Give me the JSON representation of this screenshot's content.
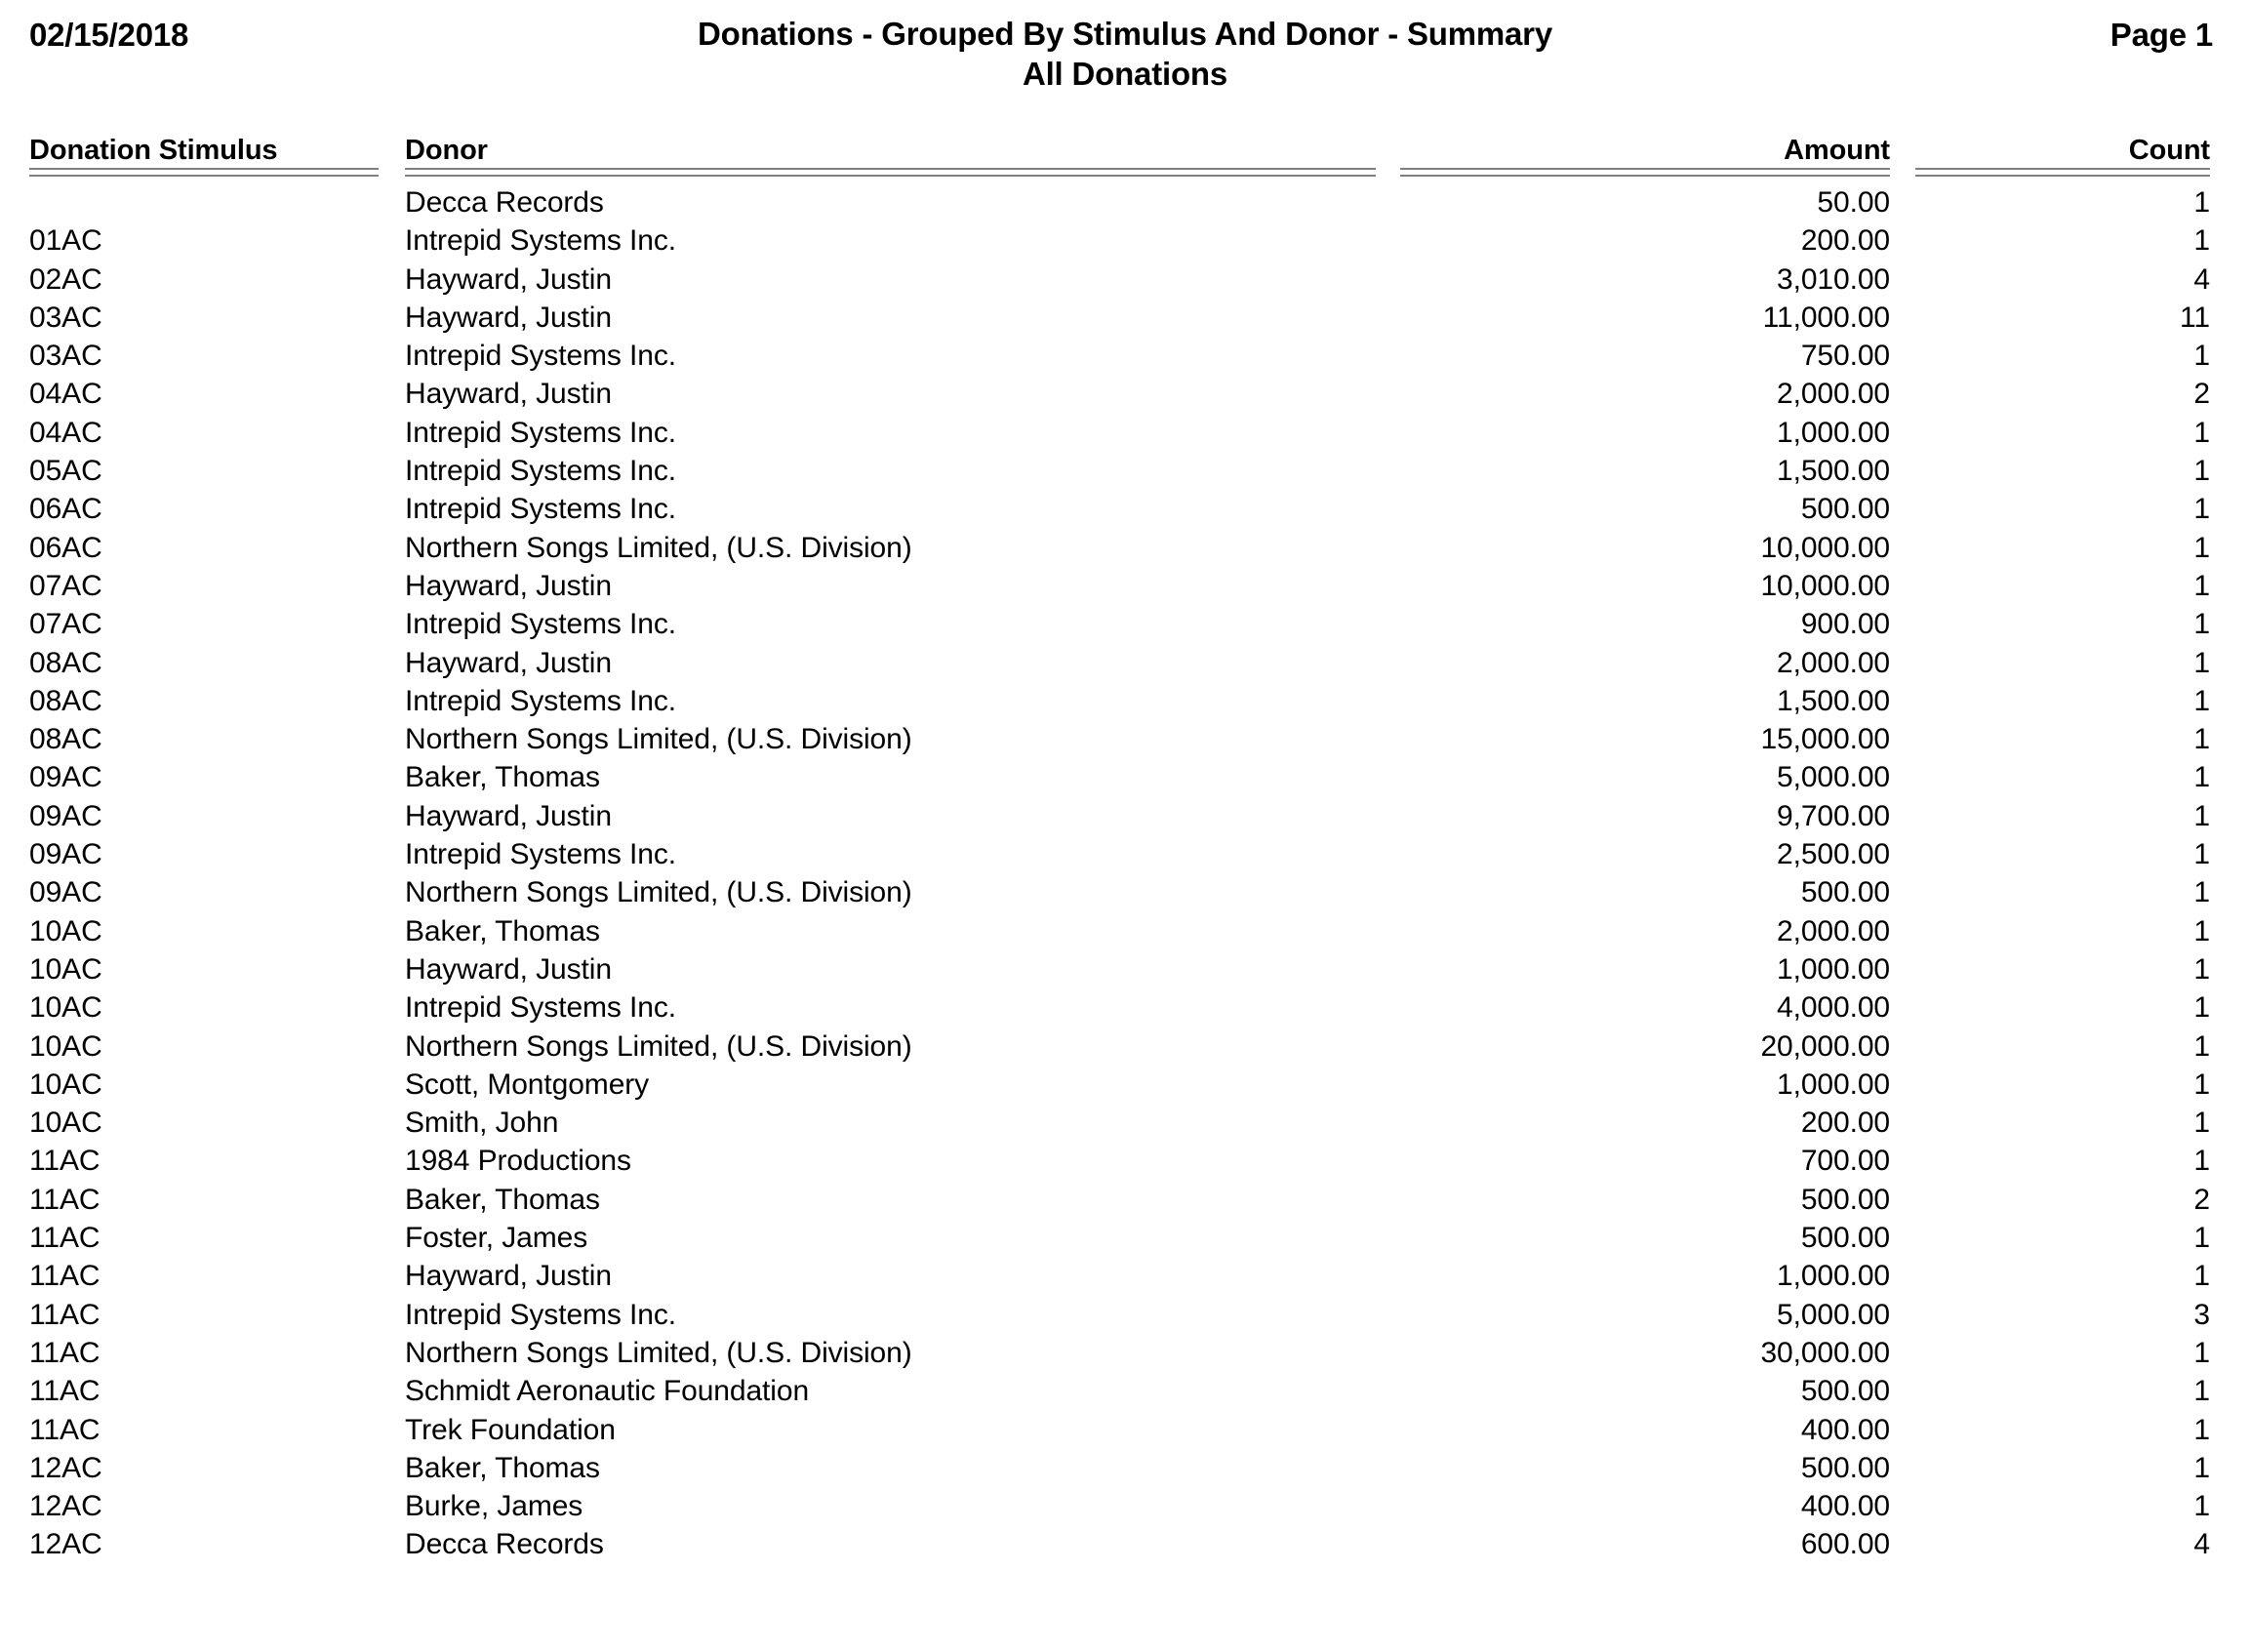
{
  "report": {
    "date": "02/15/2018",
    "title": "Donations - Grouped By Stimulus And Donor - Summary",
    "subtitle": "All Donations",
    "page_label": "Page 1"
  },
  "table": {
    "columns": {
      "stimulus": "Donation Stimulus",
      "donor": "Donor",
      "amount": "Amount",
      "count": "Count"
    },
    "rows": [
      {
        "stimulus": "",
        "donor": "Decca Records",
        "amount": "50.00",
        "count": "1"
      },
      {
        "stimulus": "01AC",
        "donor": "Intrepid Systems Inc.",
        "amount": "200.00",
        "count": "1"
      },
      {
        "stimulus": "02AC",
        "donor": "Hayward, Justin",
        "amount": "3,010.00",
        "count": "4"
      },
      {
        "stimulus": "03AC",
        "donor": "Hayward, Justin",
        "amount": "11,000.00",
        "count": "11"
      },
      {
        "stimulus": "03AC",
        "donor": "Intrepid Systems Inc.",
        "amount": "750.00",
        "count": "1"
      },
      {
        "stimulus": "04AC",
        "donor": "Hayward, Justin",
        "amount": "2,000.00",
        "count": "2"
      },
      {
        "stimulus": "04AC",
        "donor": "Intrepid Systems Inc.",
        "amount": "1,000.00",
        "count": "1"
      },
      {
        "stimulus": "05AC",
        "donor": "Intrepid Systems Inc.",
        "amount": "1,500.00",
        "count": "1"
      },
      {
        "stimulus": "06AC",
        "donor": "Intrepid Systems Inc.",
        "amount": "500.00",
        "count": "1"
      },
      {
        "stimulus": "06AC",
        "donor": "Northern Songs Limited, (U.S. Division)",
        "amount": "10,000.00",
        "count": "1"
      },
      {
        "stimulus": "07AC",
        "donor": "Hayward, Justin",
        "amount": "10,000.00",
        "count": "1"
      },
      {
        "stimulus": "07AC",
        "donor": "Intrepid Systems Inc.",
        "amount": "900.00",
        "count": "1"
      },
      {
        "stimulus": "08AC",
        "donor": "Hayward, Justin",
        "amount": "2,000.00",
        "count": "1"
      },
      {
        "stimulus": "08AC",
        "donor": "Intrepid Systems Inc.",
        "amount": "1,500.00",
        "count": "1"
      },
      {
        "stimulus": "08AC",
        "donor": "Northern Songs Limited, (U.S. Division)",
        "amount": "15,000.00",
        "count": "1"
      },
      {
        "stimulus": "09AC",
        "donor": "Baker, Thomas",
        "amount": "5,000.00",
        "count": "1"
      },
      {
        "stimulus": "09AC",
        "donor": "Hayward, Justin",
        "amount": "9,700.00",
        "count": "1"
      },
      {
        "stimulus": "09AC",
        "donor": "Intrepid Systems Inc.",
        "amount": "2,500.00",
        "count": "1"
      },
      {
        "stimulus": "09AC",
        "donor": "Northern Songs Limited, (U.S. Division)",
        "amount": "500.00",
        "count": "1"
      },
      {
        "stimulus": "10AC",
        "donor": "Baker, Thomas",
        "amount": "2,000.00",
        "count": "1"
      },
      {
        "stimulus": "10AC",
        "donor": "Hayward, Justin",
        "amount": "1,000.00",
        "count": "1"
      },
      {
        "stimulus": "10AC",
        "donor": "Intrepid Systems Inc.",
        "amount": "4,000.00",
        "count": "1"
      },
      {
        "stimulus": "10AC",
        "donor": "Northern Songs Limited, (U.S. Division)",
        "amount": "20,000.00",
        "count": "1"
      },
      {
        "stimulus": "10AC",
        "donor": "Scott, Montgomery",
        "amount": "1,000.00",
        "count": "1"
      },
      {
        "stimulus": "10AC",
        "donor": "Smith, John",
        "amount": "200.00",
        "count": "1"
      },
      {
        "stimulus": "11AC",
        "donor": "1984 Productions",
        "amount": "700.00",
        "count": "1"
      },
      {
        "stimulus": "11AC",
        "donor": "Baker, Thomas",
        "amount": "500.00",
        "count": "2"
      },
      {
        "stimulus": "11AC",
        "donor": "Foster, James",
        "amount": "500.00",
        "count": "1"
      },
      {
        "stimulus": "11AC",
        "donor": "Hayward, Justin",
        "amount": "1,000.00",
        "count": "1"
      },
      {
        "stimulus": "11AC",
        "donor": "Intrepid Systems Inc.",
        "amount": "5,000.00",
        "count": "3"
      },
      {
        "stimulus": "11AC",
        "donor": "Northern Songs Limited, (U.S. Division)",
        "amount": "30,000.00",
        "count": "1"
      },
      {
        "stimulus": "11AC",
        "donor": "Schmidt Aeronautic Foundation",
        "amount": "500.00",
        "count": "1"
      },
      {
        "stimulus": "11AC",
        "donor": "Trek Foundation",
        "amount": "400.00",
        "count": "1"
      },
      {
        "stimulus": "12AC",
        "donor": "Baker, Thomas",
        "amount": "500.00",
        "count": "1"
      },
      {
        "stimulus": "12AC",
        "donor": "Burke, James",
        "amount": "400.00",
        "count": "1"
      },
      {
        "stimulus": "12AC",
        "donor": "Decca Records",
        "amount": "600.00",
        "count": "4"
      }
    ]
  }
}
